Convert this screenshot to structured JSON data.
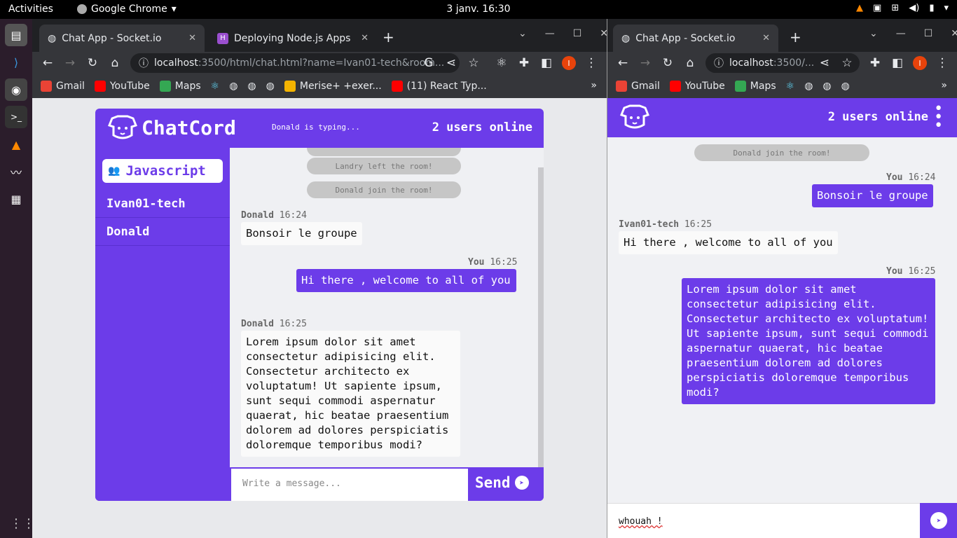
{
  "os": {
    "activities": "Activities",
    "app_name": "Google Chrome",
    "clock": "3 janv.  16:30"
  },
  "win1": {
    "tabs": [
      {
        "title": "Chat App - Socket.io"
      },
      {
        "title": "Deploying Node.js Apps o"
      }
    ],
    "url_host": "localhost",
    "url_rest": ":3500/html/chat.html?name=Ivan01-tech&room...",
    "profile": "I"
  },
  "win2": {
    "tabs": [
      {
        "title": "Chat App - Socket.io"
      }
    ],
    "url_host": "localhost",
    "url_rest": ":3500/...",
    "profile": "I"
  },
  "bookmarks": {
    "win1": [
      "Gmail",
      "YouTube",
      "Maps",
      "Merise+ +exer...",
      "(11) React Typ..."
    ],
    "win2": [
      "Gmail",
      "YouTube",
      "Maps"
    ]
  },
  "chat": {
    "brand": "ChatCord",
    "typing": "Donald is typing...",
    "online": "2 users online",
    "room": "Javascript",
    "users": [
      "Ivan01-tech",
      "Donald"
    ],
    "system": [
      "Landry left the room!",
      "Donald join the room!"
    ],
    "messages": [
      {
        "author": "Donald",
        "time": "16:24",
        "text": "Bonsoir le groupe"
      },
      {
        "author": "You",
        "time": "16:25",
        "text": "Hi there , welcome to all of you"
      },
      {
        "author": "Donald",
        "time": "16:25",
        "text": "Lorem ipsum dolor sit amet consectetur adipisicing elit. Consectetur architecto ex voluptatum! Ut sapiente ipsum, sunt sequi commodi aspernatur quaerat, hic beatae praesentium dolorem ad dolores perspiciatis doloremque temporibus modi?"
      }
    ],
    "input_placeholder": "Write a message...",
    "send_label": "Send"
  },
  "chat2": {
    "online": "2 users online",
    "system": "Donald join the room!",
    "messages": [
      {
        "author": "You",
        "time": "16:24",
        "text": "Bonsoir le groupe"
      },
      {
        "author": "Ivan01-tech",
        "time": "16:25",
        "text": "Hi there , welcome to all of you"
      },
      {
        "author": "You",
        "time": "16:25",
        "text": "Lorem ipsum dolor sit amet consectetur adipisicing elit. Consectetur architecto ex voluptatum! Ut sapiente ipsum, sunt sequi commodi aspernatur quaerat, hic beatae praesentium dolorem ad dolores perspiciatis doloremque temporibus modi?"
      }
    ],
    "input_value": "whouah !"
  },
  "colors": {
    "accent": "#6c3ce9"
  }
}
